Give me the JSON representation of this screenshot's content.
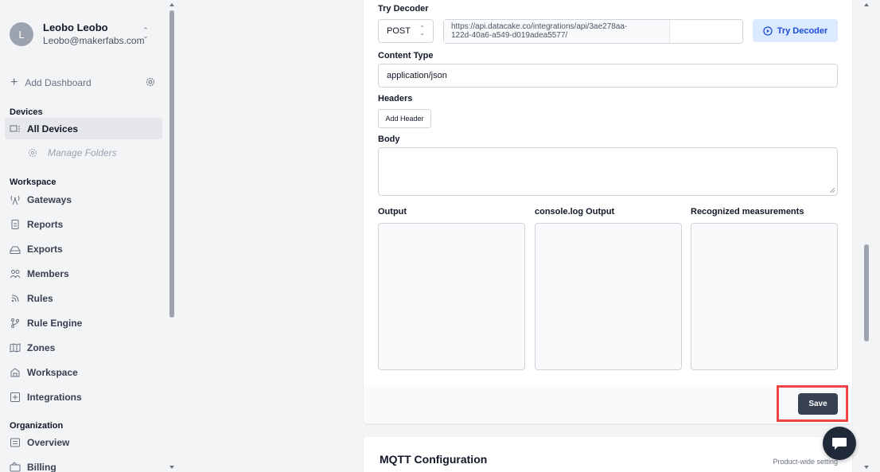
{
  "user": {
    "avatar_letter": "L",
    "name": "Leobo Leobo",
    "email": "Leobo@makerfabs.com"
  },
  "sidebar": {
    "add_dashboard": "Add Dashboard",
    "sections": {
      "devices": "Devices",
      "workspace": "Workspace",
      "organization": "Organization"
    },
    "items": {
      "all_devices": "All Devices",
      "manage_folders": "Manage Folders",
      "gateways": "Gateways",
      "reports": "Reports",
      "exports": "Exports",
      "members": "Members",
      "rules": "Rules",
      "rule_engine": "Rule Engine",
      "zones": "Zones",
      "workspace": "Workspace",
      "integrations": "Integrations",
      "overview": "Overview",
      "billing": "Billing"
    }
  },
  "decoder": {
    "title": "Try Decoder",
    "method": "POST",
    "url_line1": "https://api.datacake.co/integrations/api/3ae278aa-",
    "url_line2": "122d-40a6-a549-d019adea5577/",
    "try_button": "Try Decoder",
    "content_type_label": "Content Type",
    "content_type_value": "application/json",
    "headers_label": "Headers",
    "add_header_button": "Add Header",
    "body_label": "Body",
    "output_label": "Output",
    "console_label": "console.log Output",
    "measurements_label": "Recognized measurements",
    "save_button": "Save"
  },
  "mqtt": {
    "title": "MQTT Configuration",
    "scope": "Product-wide setting"
  },
  "colors": {
    "accent_bg": "#dbeafe",
    "accent_text": "#1d4ed8",
    "save_bg": "#374151",
    "highlight": "#ef4444"
  }
}
